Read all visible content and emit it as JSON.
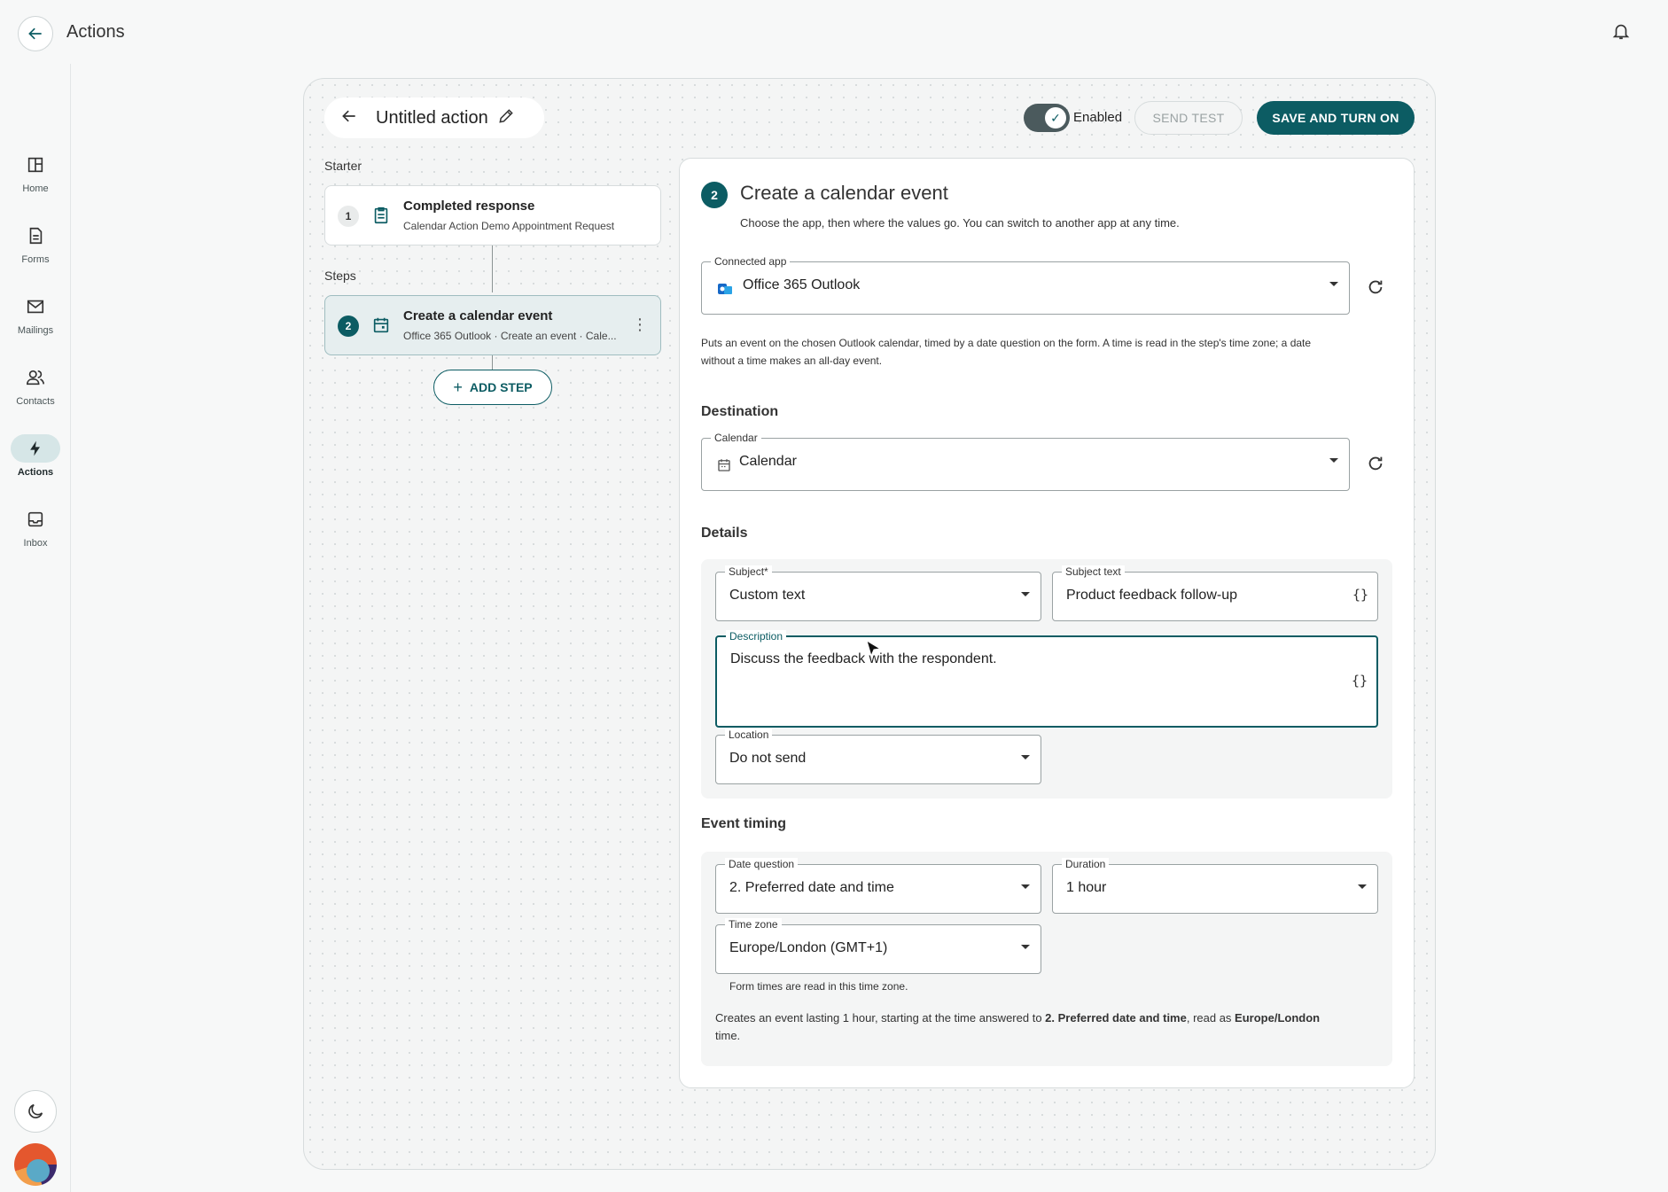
{
  "header": {
    "title": "Actions"
  },
  "nav": {
    "items": [
      {
        "label": "Home",
        "icon": "home-icon"
      },
      {
        "label": "Forms",
        "icon": "forms-icon"
      },
      {
        "label": "Mailings",
        "icon": "mail-icon"
      },
      {
        "label": "Contacts",
        "icon": "contacts-icon"
      },
      {
        "label": "Actions",
        "icon": "bolt-icon",
        "active": true
      },
      {
        "label": "Inbox",
        "icon": "inbox-icon"
      }
    ]
  },
  "toolbar": {
    "action_title": "Untitled action",
    "enabled_label": "Enabled",
    "enabled": true,
    "send_test_label": "SEND TEST",
    "save_label": "SAVE AND TURN ON"
  },
  "flow": {
    "starter_label": "Starter",
    "steps_label": "Steps",
    "starter": {
      "num": "1",
      "title": "Completed response",
      "subtitle": "Calendar Action Demo Appointment Request"
    },
    "steps": [
      {
        "num": "2",
        "title": "Create a calendar event",
        "subtitle": "Office 365 Outlook · Create an event · Cale..."
      }
    ],
    "add_step_label": "ADD STEP"
  },
  "panel": {
    "num": "2",
    "title": "Create a calendar event",
    "subtitle": "Choose the app, then where the values go. You can switch to another app at any time.",
    "connected_app": {
      "label": "Connected app",
      "value": "Office 365 Outlook"
    },
    "app_note_line1": "Puts an event on the chosen Outlook calendar, timed by a date question on the form. A time is read in the step's time zone; a date",
    "app_note_line2": "without a time makes an all-day event.",
    "destination": {
      "heading": "Destination",
      "calendar": {
        "label": "Calendar",
        "value": "Calendar"
      }
    },
    "details": {
      "heading": "Details",
      "subject": {
        "label": "Subject*",
        "value": "Custom text"
      },
      "subject_text": {
        "label": "Subject text",
        "value": "Product feedback follow-up"
      },
      "description": {
        "label": "Description",
        "value": "Discuss the feedback with the respondent."
      },
      "location": {
        "label": "Location",
        "value": "Do not send"
      }
    },
    "timing": {
      "heading": "Event timing",
      "date_question": {
        "label": "Date question",
        "value": "2. Preferred date and time"
      },
      "duration": {
        "label": "Duration",
        "value": "1 hour"
      },
      "time_zone": {
        "label": "Time zone",
        "value": "Europe/London (GMT+1)"
      },
      "tz_helper": "Form times are read in this time zone.",
      "summary_pre": "Creates an event lasting 1 hour, starting at the time answered to ",
      "summary_q": "2. Preferred date and time",
      "summary_mid": ", read as ",
      "summary_tz": "Europe/London",
      "summary_post": "time."
    }
  },
  "colors": {
    "accent": "#0c5c63",
    "toggle_track": "#4b5a5d"
  }
}
